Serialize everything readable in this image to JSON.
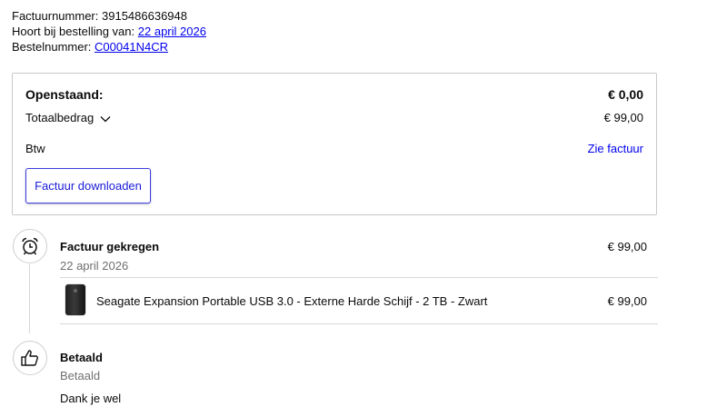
{
  "invoice": {
    "number_label": "Factuurnummer:",
    "number": "3915486636948",
    "order_date_label": "Hoort bij bestelling van:",
    "order_date": "22 april 2026",
    "order_number_label": "Bestelnummer:",
    "order_number": "C00041N4CR"
  },
  "summary": {
    "outstanding_label": "Openstaand:",
    "outstanding_value": "€ 0,00",
    "total_label": "Totaalbedrag",
    "total_value": "€ 99,00",
    "vat_label": "Btw",
    "vat_link": "Zie factuur",
    "download_button": "Factuur downloaden"
  },
  "timeline": {
    "received": {
      "title": "Factuur gekregen",
      "date": "22 april 2026",
      "amount": "€ 99,00",
      "icon": "alarm-clock-icon"
    },
    "product": {
      "name": "Seagate Expansion Portable USB 3.0 - Externe Harde Schijf - 2 TB - Zwart",
      "amount": "€ 99,00"
    },
    "paid": {
      "title": "Betaald",
      "status": "Betaald",
      "message": "Dank je wel",
      "icon": "thumbs-up-icon"
    }
  },
  "colors": {
    "link": "#0000ee",
    "button_border": "#3d3dde",
    "border": "#c9c9c9"
  }
}
